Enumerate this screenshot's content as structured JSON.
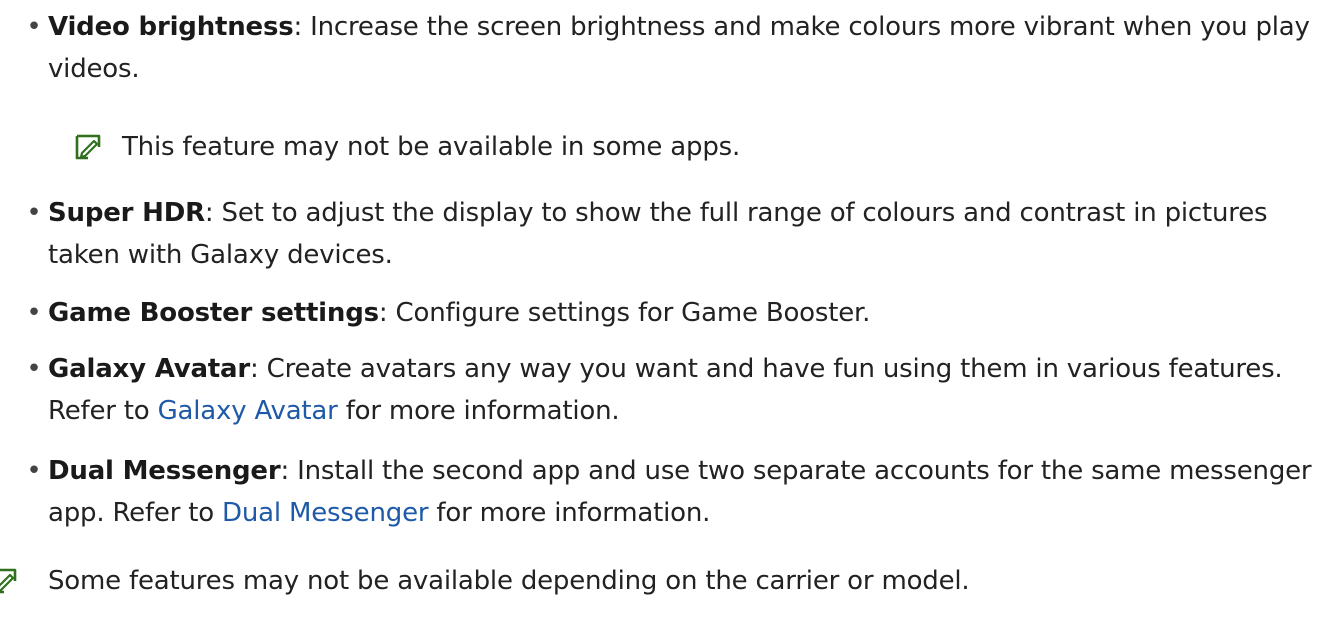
{
  "items": [
    {
      "term": "Video brightness",
      "sep": ":",
      "text": " Increase the screen brightness and make colours more vibrant when you play videos."
    },
    {
      "term": "Super HDR",
      "sep": ":",
      "text": " Set to adjust the display to show the full range of colours and contrast in pictures taken with Galaxy devices."
    },
    {
      "term": "Game Booster settings",
      "sep": ":",
      "text": " Configure settings for Game Booster."
    },
    {
      "term": "Galaxy Avatar",
      "sep": ":",
      "text": " Create avatars any way you want and have fun using them in various features. Refer to ",
      "link": "Galaxy Avatar",
      "after": " for more information."
    },
    {
      "term": "Dual Messenger",
      "sep": ":",
      "text": " Install the second app and use two separate accounts for the same messenger app. Refer to ",
      "link": "Dual Messenger",
      "after": " for more information."
    }
  ],
  "bullet": "•",
  "notes": {
    "inner": "This feature may not be available in some apps.",
    "outer": "Some features may not be available depending on the carrier or model."
  },
  "colors": {
    "link": "#1e5aa8",
    "text": "#222222",
    "icon": "#2f6f1e"
  },
  "icons": {
    "note": "note-pencil-icon"
  }
}
